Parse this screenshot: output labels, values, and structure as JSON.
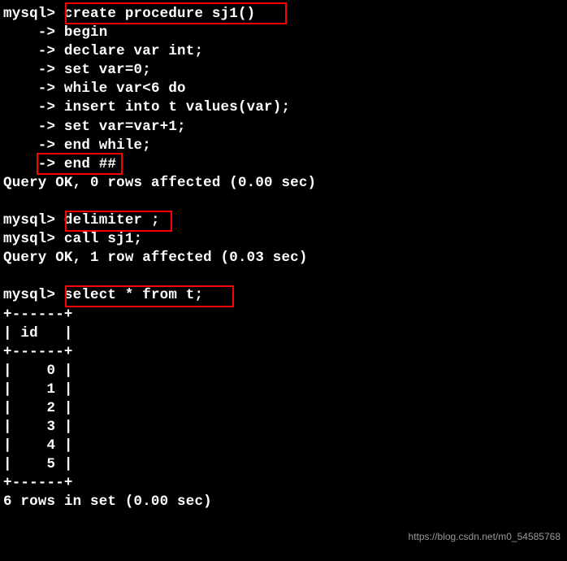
{
  "prompt_mysql": "mysql>",
  "prompt_cont": "    ->",
  "lines": {
    "l1": " create procedure sj1()",
    "l2": " begin",
    "l3": " declare var int;",
    "l4": " set var=0;",
    "l5": " while var<6 do",
    "l6": " insert into t values(var);",
    "l7": " set var=var+1;",
    "l8": " end while;",
    "l9": " end ##",
    "l10": "Query OK, 0 rows affected (0.00 sec)",
    "l11": "",
    "l12": " delimiter ;",
    "l13": " call sj1;",
    "l14": "Query OK, 1 row affected (0.03 sec)",
    "l15": "",
    "l16": " select * from t;",
    "l17": "+------+",
    "l18": "| id   |",
    "l19": "+------+",
    "l20": "|    0 |",
    "l21": "|    1 |",
    "l22": "|    2 |",
    "l23": "|    3 |",
    "l24": "|    4 |",
    "l25": "|    5 |",
    "l26": "+------+",
    "l27": "6 rows in set (0.00 sec)"
  },
  "watermark": "https://blog.csdn.net/m0_54585768"
}
